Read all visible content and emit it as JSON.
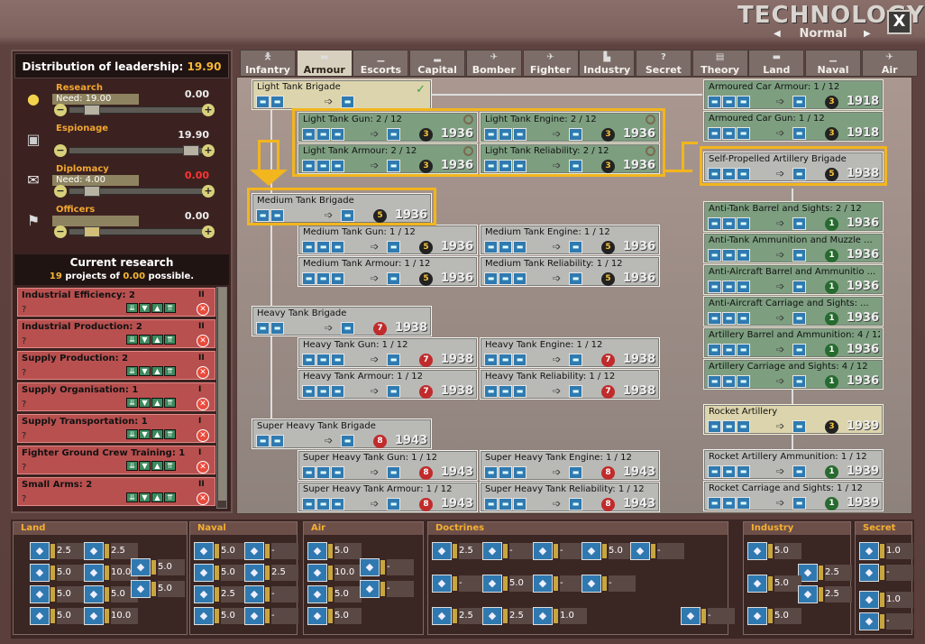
{
  "window": {
    "title": "TECHNOLOGY",
    "mode": "Normal",
    "close_label": "X"
  },
  "leadership": {
    "dist_label": "Distribution of leadership:",
    "dist_value": "19.90",
    "rows": [
      {
        "name": "Research",
        "need": "Need: 19.00",
        "value": "0.00",
        "value_color": "#ffffff"
      },
      {
        "name": "Espionage",
        "need": "",
        "value": "19.90",
        "value_color": "#ffffff"
      },
      {
        "name": "Diplomacy",
        "need": "Need: 4.00",
        "value": "0.00",
        "value_color": "#ff3333"
      },
      {
        "name": "Officers",
        "need": "",
        "value": "0.00",
        "value_color": "#ffffff"
      }
    ]
  },
  "current_research": {
    "title": "Current research",
    "count": "19",
    "text1": "projects of",
    "possible": "0.00",
    "text2": "possible.",
    "items": [
      {
        "name": "Industrial Efficiency: 2",
        "level": "II",
        "eta": "?"
      },
      {
        "name": "Industrial Production: 2",
        "level": "II",
        "eta": "?"
      },
      {
        "name": "Supply Production: 2",
        "level": "II",
        "eta": "?"
      },
      {
        "name": "Supply Organisation: 1",
        "level": "I",
        "eta": "?"
      },
      {
        "name": "Supply Transportation: 1",
        "level": "I",
        "eta": "?"
      },
      {
        "name": "Fighter Ground Crew Training: 1",
        "level": "I",
        "eta": "?"
      },
      {
        "name": "Small Arms: 2",
        "level": "II",
        "eta": "?"
      }
    ]
  },
  "tabs": [
    {
      "label": "Infantry",
      "icon": "infantry-icon"
    },
    {
      "label": "Armour",
      "icon": "tank-icon"
    },
    {
      "label": "Escorts",
      "icon": "escort-icon"
    },
    {
      "label": "Capital",
      "icon": "battleship-icon"
    },
    {
      "label": "Bomber",
      "icon": "bomber-icon"
    },
    {
      "label": "Fighter",
      "icon": "fighter-icon"
    },
    {
      "label": "Industry",
      "icon": "factory-icon"
    },
    {
      "label": "Secret",
      "icon": "question-icon"
    },
    {
      "label": "Theory",
      "icon": "book-icon"
    },
    {
      "label": "Land",
      "icon": "land-icon"
    },
    {
      "label": "Naval",
      "icon": "naval-icon"
    },
    {
      "label": "Air",
      "icon": "air-icon"
    }
  ],
  "tree": {
    "nodes": [
      {
        "name": "Light Tank Brigade",
        "cost": "",
        "year": "",
        "style": "gold"
      },
      {
        "name": "Light Tank Gun: 2 / 12",
        "cost": "3",
        "year": "1936",
        "style": "green"
      },
      {
        "name": "Light Tank Engine: 2 / 12",
        "cost": "3",
        "year": "1936",
        "style": "green"
      },
      {
        "name": "Light Tank Armour: 2 / 12",
        "cost": "3",
        "year": "1936",
        "style": "green"
      },
      {
        "name": "Light Tank Reliability: 2 / 12",
        "cost": "3",
        "year": "1936",
        "style": "green"
      },
      {
        "name": "Medium Tank Brigade",
        "cost": "5",
        "year": "1936",
        "style": "grey"
      },
      {
        "name": "Medium Tank Gun: 1 / 12",
        "cost": "5",
        "year": "1936",
        "style": "grey"
      },
      {
        "name": "Medium Tank Engine: 1 / 12",
        "cost": "5",
        "year": "1936",
        "style": "grey"
      },
      {
        "name": "Medium Tank Armour: 1 / 12",
        "cost": "5",
        "year": "1936",
        "style": "grey"
      },
      {
        "name": "Medium Tank Reliability: 1 / 12",
        "cost": "5",
        "year": "1936",
        "style": "grey"
      },
      {
        "name": "Heavy Tank Brigade",
        "cost": "7",
        "year": "1938",
        "style": "grey"
      },
      {
        "name": "Heavy Tank Gun: 1 / 12",
        "cost": "7",
        "year": "1938",
        "style": "grey"
      },
      {
        "name": "Heavy Tank Engine: 1 / 12",
        "cost": "7",
        "year": "1938",
        "style": "grey"
      },
      {
        "name": "Heavy Tank Armour: 1 / 12",
        "cost": "7",
        "year": "1938",
        "style": "grey"
      },
      {
        "name": "Heavy Tank Reliability: 1 / 12",
        "cost": "7",
        "year": "1938",
        "style": "grey"
      },
      {
        "name": "Super Heavy Tank Brigade",
        "cost": "8",
        "year": "1943",
        "style": "grey"
      },
      {
        "name": "Super Heavy Tank Gun: 1 / 12",
        "cost": "8",
        "year": "1943",
        "style": "grey"
      },
      {
        "name": "Super Heavy Tank Engine: 1 / 12",
        "cost": "8",
        "year": "1943",
        "style": "grey"
      },
      {
        "name": "Super Heavy Tank Armour: 1 / 12",
        "cost": "8",
        "year": "1943",
        "style": "grey"
      },
      {
        "name": "Super Heavy Tank Reliability: 1 / 12",
        "cost": "8",
        "year": "1943",
        "style": "grey"
      },
      {
        "name": "Armoured Car Armour: 1 / 12",
        "cost": "3",
        "year": "1918",
        "style": "green"
      },
      {
        "name": "Armoured Car Gun: 1 / 12",
        "cost": "3",
        "year": "1918",
        "style": "green"
      },
      {
        "name": "Self-Propelled Artillery Brigade",
        "cost": "5",
        "year": "1938",
        "style": "grey"
      },
      {
        "name": "Anti-Tank Barrel and Sights: 2 / 12",
        "cost": "1",
        "year": "1936",
        "style": "green"
      },
      {
        "name": "Anti-Tank Ammunition and Muzzle ...",
        "cost": "1",
        "year": "1936",
        "style": "green"
      },
      {
        "name": "Anti-Aircraft Barrel and Ammunitio ...",
        "cost": "1",
        "year": "1936",
        "style": "green"
      },
      {
        "name": "Anti-Aircraft Carriage and Sights: ...",
        "cost": "1",
        "year": "1936",
        "style": "green"
      },
      {
        "name": "Artillery Barrel and Ammunition: 4 / 12",
        "cost": "1",
        "year": "1936",
        "style": "green"
      },
      {
        "name": "Artillery Carriage and Sights: 4 / 12",
        "cost": "1",
        "year": "1936",
        "style": "green"
      },
      {
        "name": "Rocket Artillery",
        "cost": "3",
        "year": "1939",
        "style": "gold"
      },
      {
        "name": "Rocket Artillery Ammunition: 1 / 12",
        "cost": "1",
        "year": "1939",
        "style": "grey"
      },
      {
        "name": "Rocket Carriage and Sights: 1 / 12",
        "cost": "1",
        "year": "1939",
        "style": "grey"
      }
    ]
  },
  "bottom": {
    "land": {
      "label": "Land",
      "values": [
        "2.5",
        "2.5",
        "5.0",
        "10.0",
        "5.0",
        "5.0",
        "5.0",
        "5.0",
        "5.0",
        "10.0"
      ]
    },
    "naval": {
      "label": "Naval",
      "values": [
        "5.0",
        "-",
        "5.0",
        "2.5",
        "2.5",
        "-",
        "5.0",
        "-"
      ]
    },
    "air": {
      "label": "Air",
      "values": [
        "5.0",
        "10.0",
        "5.0",
        "5.0",
        "-",
        "-"
      ]
    },
    "doctrines": {
      "label": "Doctrines",
      "values": [
        "2.5",
        "-",
        "-",
        "5.0",
        "-",
        "-",
        "5.0",
        "-",
        "-",
        "2.5",
        "2.5",
        "1.0",
        "-"
      ]
    },
    "industry": {
      "label": "Industry",
      "values": [
        "5.0",
        "2.5",
        "5.0",
        "2.5",
        "5.0"
      ]
    },
    "secret": {
      "label": "Secret",
      "values": [
        "1.0",
        "-",
        "1.0",
        "-"
      ]
    }
  }
}
